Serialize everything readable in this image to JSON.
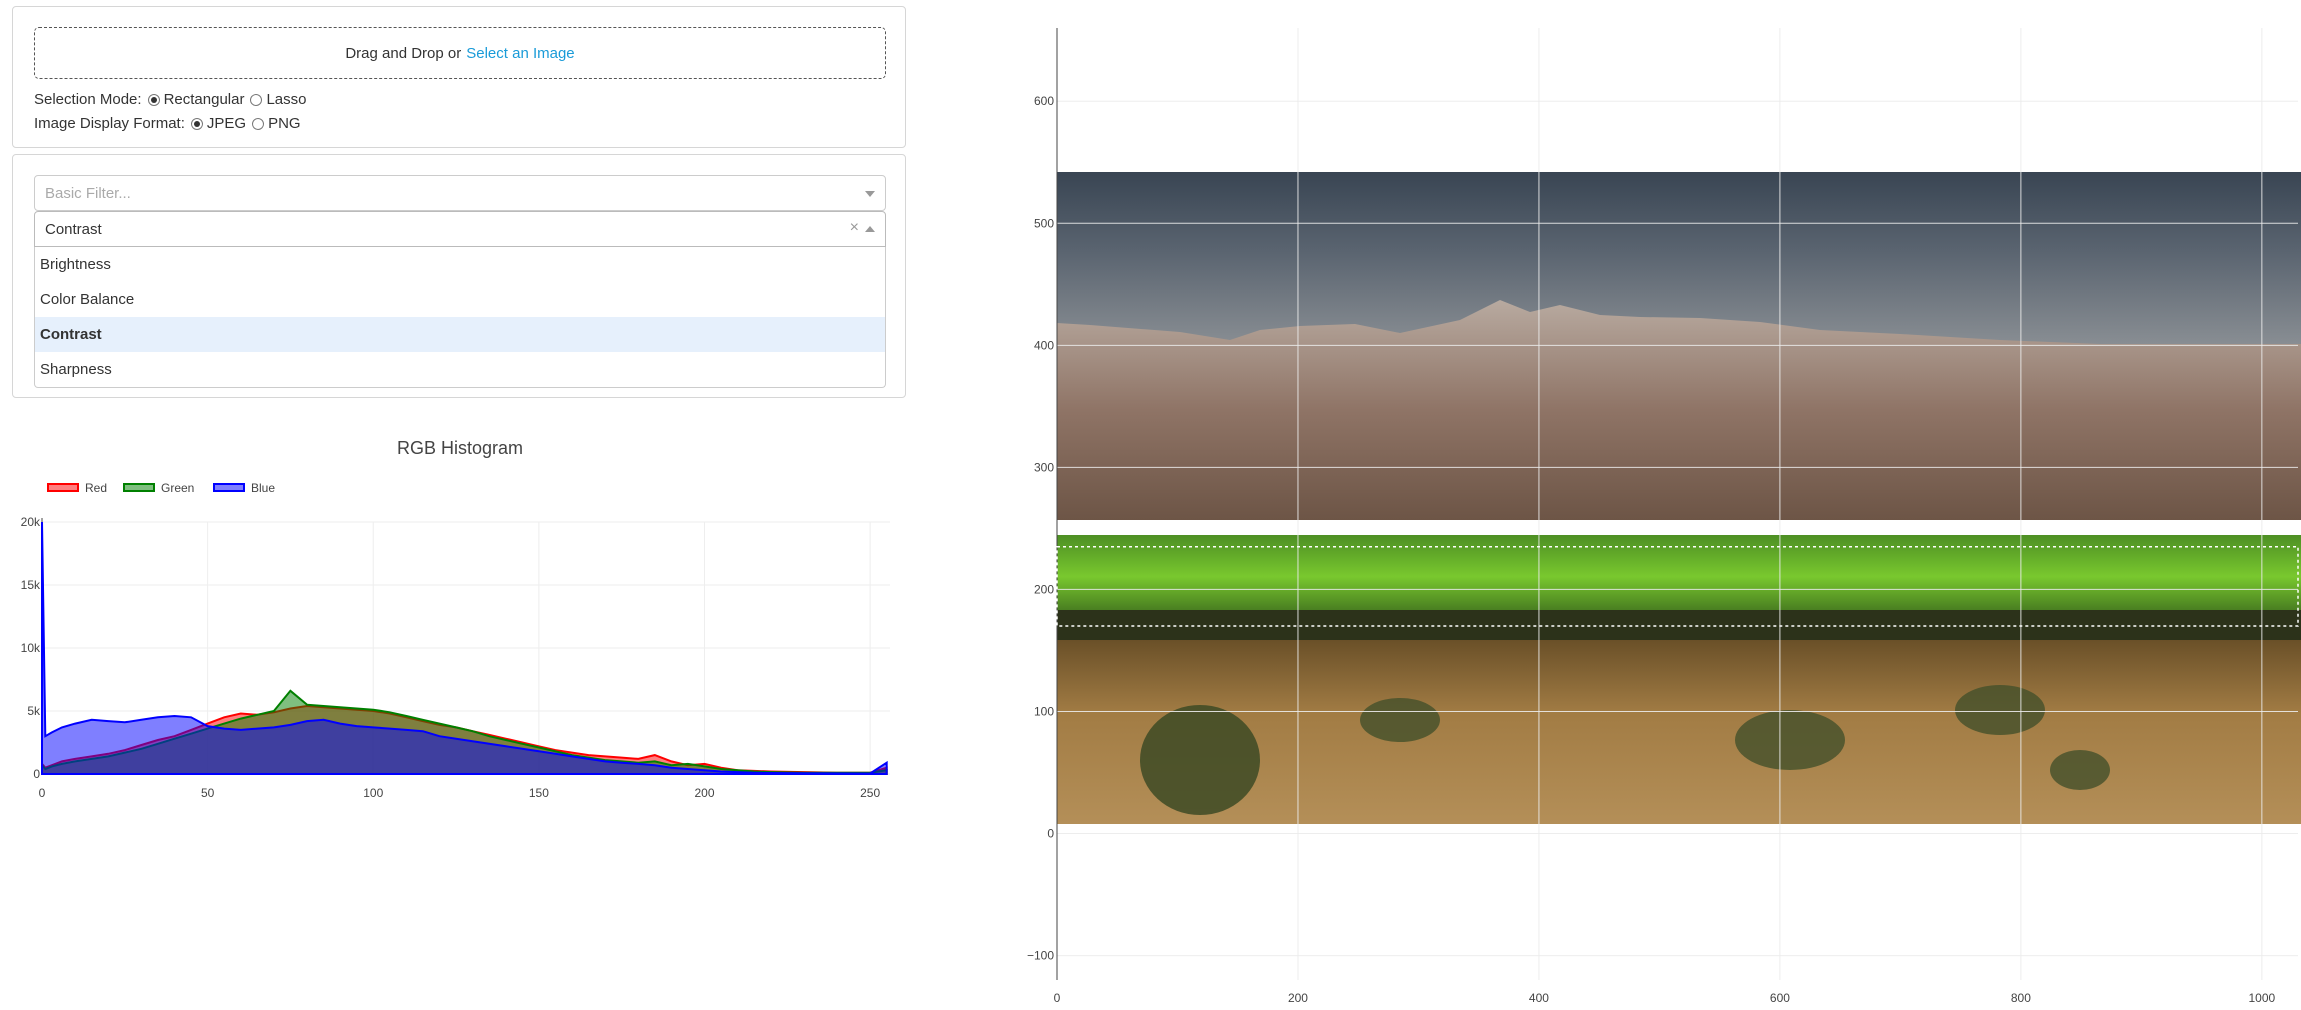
{
  "upload": {
    "prompt": "Drag and Drop or",
    "link": "Select an Image",
    "selection_mode": {
      "label": "Selection Mode:",
      "options": [
        "Rectangular",
        "Lasso"
      ],
      "selected": "Rectangular"
    },
    "display_format": {
      "label": "Image Display Format:",
      "options": [
        "JPEG",
        "PNG"
      ],
      "selected": "JPEG"
    }
  },
  "filters": {
    "basic_placeholder": "Basic Filter...",
    "advanced_value": "Contrast",
    "clear_glyph": "×",
    "options": [
      "Brightness",
      "Color Balance",
      "Contrast",
      "Sharpness"
    ],
    "selected": "Contrast"
  },
  "histogram": {
    "title": "RGB Histogram",
    "legend": [
      "Red",
      "Green",
      "Blue"
    ],
    "colors": {
      "red": "#ff0000",
      "green": "#008000",
      "blue": "#0000ff"
    }
  },
  "image_plot": {
    "x_ticks": [
      "0",
      "200",
      "400",
      "600",
      "800",
      "1000"
    ],
    "y_ticks": [
      "−100",
      "0",
      "100",
      "200",
      "300",
      "400",
      "500",
      "600"
    ]
  },
  "chart_data": [
    {
      "type": "area",
      "title": "RGB Histogram",
      "xlabel": "",
      "ylabel": "",
      "xlim": [
        0,
        256
      ],
      "ylim": [
        0,
        20000
      ],
      "x_ticks": [
        0,
        50,
        100,
        150,
        200,
        250
      ],
      "y_ticks": [
        "0",
        "5k",
        "10k",
        "15k",
        "20k"
      ],
      "legend": "top-left",
      "x": [
        0,
        1,
        3,
        6,
        10,
        15,
        20,
        25,
        30,
        35,
        40,
        45,
        50,
        55,
        60,
        65,
        70,
        75,
        80,
        85,
        90,
        95,
        100,
        105,
        110,
        115,
        120,
        125,
        130,
        135,
        140,
        145,
        150,
        155,
        160,
        165,
        170,
        175,
        180,
        185,
        190,
        195,
        200,
        205,
        210,
        215,
        220,
        230,
        240,
        250,
        255
      ],
      "series": [
        {
          "name": "Red",
          "values": [
            800,
            500,
            700,
            1000,
            1200,
            1400,
            1600,
            1900,
            2300,
            2700,
            3000,
            3500,
            4000,
            4500,
            4800,
            4700,
            4900,
            5200,
            5400,
            5300,
            5200,
            5100,
            5000,
            4800,
            4500,
            4200,
            3900,
            3700,
            3400,
            3100,
            2800,
            2500,
            2200,
            1900,
            1700,
            1500,
            1400,
            1300,
            1200,
            1500,
            1000,
            700,
            800,
            500,
            300,
            250,
            200,
            150,
            100,
            100,
            500
          ]
        },
        {
          "name": "Green",
          "values": [
            700,
            400,
            600,
            800,
            1000,
            1200,
            1400,
            1700,
            2000,
            2400,
            2800,
            3200,
            3600,
            4000,
            4400,
            4700,
            5000,
            6600,
            5500,
            5400,
            5300,
            5200,
            5100,
            4900,
            4600,
            4300,
            4000,
            3700,
            3400,
            3000,
            2700,
            2400,
            2100,
            1800,
            1500,
            1300,
            1100,
            1000,
            900,
            1000,
            700,
            800,
            600,
            400,
            300,
            200,
            150,
            100,
            100,
            100,
            300
          ]
        },
        {
          "name": "Blue",
          "values": [
            20000,
            3000,
            3300,
            3700,
            4000,
            4300,
            4200,
            4100,
            4300,
            4500,
            4600,
            4500,
            3800,
            3600,
            3500,
            3600,
            3700,
            3900,
            4200,
            4300,
            4000,
            3800,
            3700,
            3600,
            3500,
            3400,
            3000,
            2800,
            2600,
            2400,
            2200,
            2000,
            1800,
            1600,
            1400,
            1200,
            1000,
            900,
            800,
            700,
            500,
            400,
            300,
            200,
            150,
            100,
            80,
            60,
            50,
            40,
            900
          ]
        }
      ]
    },
    {
      "type": "scatter",
      "title": "",
      "xlabel": "",
      "ylabel": "",
      "xlim": [
        0,
        1030
      ],
      "ylim": [
        -120,
        660
      ],
      "x_ticks": [
        0,
        200,
        400,
        600,
        800,
        1000
      ],
      "y_ticks": [
        -100,
        0,
        100,
        200,
        300,
        400,
        500,
        600
      ],
      "grid": true,
      "image_extent": {
        "x": [
          0,
          1030
        ],
        "y": [
          0,
          540
        ]
      },
      "selection_box": {
        "x": [
          0,
          1030
        ],
        "y": [
          170,
          235
        ]
      }
    }
  ]
}
